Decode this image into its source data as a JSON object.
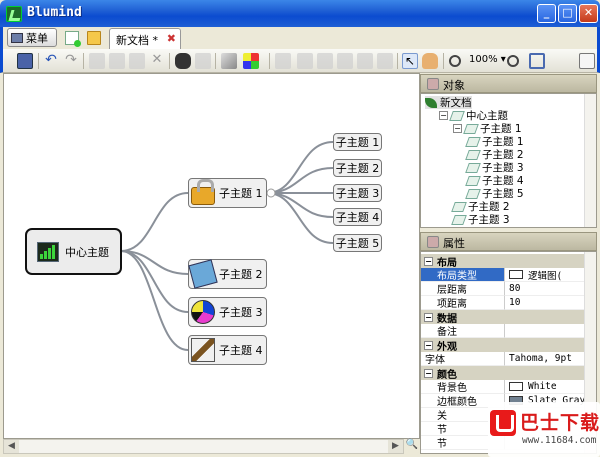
{
  "window": {
    "title": "Blumind",
    "minimize": "_",
    "maximize": "□",
    "close": "✕"
  },
  "tabs": {
    "menu_label": "菜单",
    "doc_tab_label": "新文档 *",
    "doc_tab_close": "✖"
  },
  "toolbar": {
    "zoom_level": "100%",
    "zoom_arrow": "▾"
  },
  "canvas": {
    "main_topic": "中心主题",
    "topics": [
      "子主题 1",
      "子主题 2",
      "子主题 3",
      "子主题 4"
    ],
    "subtopics": [
      "子主题 1",
      "子主题 2",
      "子主题 3",
      "子主题 4",
      "子主题 5"
    ]
  },
  "objects_panel": {
    "title": "对象",
    "tree": [
      {
        "label": "新文档",
        "level": 0,
        "expander": "",
        "selected": true
      },
      {
        "label": "中心主题",
        "level": 1,
        "expander": "⊟"
      },
      {
        "label": "子主题 1",
        "level": 2,
        "expander": "⊟"
      },
      {
        "label": "子主题 1",
        "level": 3,
        "expander": ""
      },
      {
        "label": "子主题 2",
        "level": 3,
        "expander": ""
      },
      {
        "label": "子主题 3",
        "level": 3,
        "expander": ""
      },
      {
        "label": "子主题 4",
        "level": 3,
        "expander": ""
      },
      {
        "label": "子主题 5",
        "level": 3,
        "expander": ""
      },
      {
        "label": "子主题 2",
        "level": 2,
        "expander": ""
      },
      {
        "label": "子主题 3",
        "level": 2,
        "expander": ""
      }
    ]
  },
  "properties_panel": {
    "title": "属性",
    "rows": [
      {
        "type": "cat",
        "label": "布局"
      },
      {
        "type": "prop",
        "name": "布局类型",
        "value": "逻辑图(",
        "highlight": true,
        "icon": true
      },
      {
        "type": "prop",
        "name": "层距离",
        "value": "80"
      },
      {
        "type": "prop",
        "name": "项距离",
        "value": "10"
      },
      {
        "type": "cat",
        "label": "数据"
      },
      {
        "type": "prop",
        "name": "备注",
        "value": ""
      },
      {
        "type": "cat",
        "label": "外观"
      },
      {
        "type": "prop",
        "name": "字体",
        "value": "Tahoma, 9pt",
        "expander": "⊞"
      },
      {
        "type": "cat",
        "label": "颜色"
      },
      {
        "type": "prop",
        "name": "背景色",
        "value": "White",
        "swatch": "#ffffff"
      },
      {
        "type": "prop",
        "name": "边框颜色",
        "value": "Slate Gray",
        "swatch": "#708090"
      },
      {
        "type": "prop",
        "name": "关",
        "value": ""
      },
      {
        "type": "prop",
        "name": "节",
        "value": ""
      },
      {
        "type": "prop",
        "name": "节",
        "value": ""
      }
    ]
  },
  "watermark": {
    "title": "巴士下载",
    "url": "www.11684.com"
  },
  "colors": {
    "titlebar": "#0b4bd0",
    "selection": "#316ac5",
    "node_border": "#777777",
    "connector": "#8a9099"
  }
}
